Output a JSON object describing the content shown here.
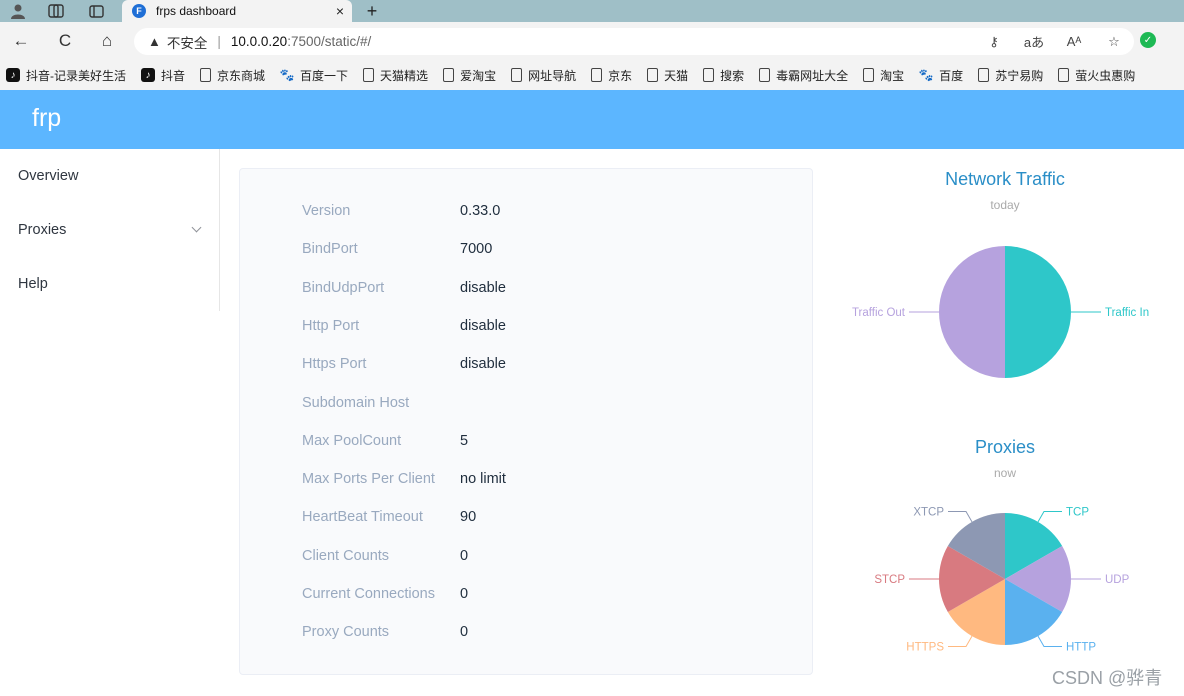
{
  "browser": {
    "tab_title": "frps dashboard",
    "tab_close": "×",
    "new_tab": "+",
    "url_warning_icon": "warning-icon",
    "url_insecure": "不安全",
    "url_separator": "|",
    "url_host": "10.0.0.20",
    "url_path": ":7500/static/#/",
    "nav": {
      "back": "←",
      "refresh": "C",
      "home": "⌂"
    },
    "url_icons": [
      "⚷",
      "aあ",
      "Aᴬ",
      "☆"
    ],
    "bookmarks": [
      {
        "label": "抖音-记录美好生活",
        "icon": "tiktok-icon"
      },
      {
        "label": "抖音",
        "icon": "tiktok-icon"
      },
      {
        "label": "京东商城",
        "icon": "page-icon"
      },
      {
        "label": "百度一下",
        "icon": "baidu-paw-icon"
      },
      {
        "label": "天猫精选",
        "icon": "page-icon"
      },
      {
        "label": "爱淘宝",
        "icon": "page-icon"
      },
      {
        "label": "网址导航",
        "icon": "page-icon"
      },
      {
        "label": "京东",
        "icon": "page-icon"
      },
      {
        "label": "天猫",
        "icon": "page-icon"
      },
      {
        "label": "搜索",
        "icon": "page-icon"
      },
      {
        "label": "毒霸网址大全",
        "icon": "page-icon"
      },
      {
        "label": "淘宝",
        "icon": "page-icon"
      },
      {
        "label": "百度",
        "icon": "baidu-paw-icon"
      },
      {
        "label": "苏宁易购",
        "icon": "page-icon"
      },
      {
        "label": "萤火虫惠购",
        "icon": "page-icon"
      }
    ]
  },
  "app": {
    "logo": "frp",
    "menu": [
      {
        "label": "Overview"
      },
      {
        "label": "Proxies"
      },
      {
        "label": "Help"
      }
    ]
  },
  "overview": {
    "rows": [
      {
        "key": "Version",
        "value": "0.33.0"
      },
      {
        "key": "BindPort",
        "value": "7000"
      },
      {
        "key": "BindUdpPort",
        "value": "disable"
      },
      {
        "key": "Http Port",
        "value": "disable"
      },
      {
        "key": "Https Port",
        "value": "disable"
      },
      {
        "key": "Subdomain Host",
        "value": ""
      },
      {
        "key": "Max PoolCount",
        "value": "5"
      },
      {
        "key": "Max Ports Per Client",
        "value": "no limit"
      },
      {
        "key": "HeartBeat Timeout",
        "value": "90"
      },
      {
        "key": "Client Counts",
        "value": "0"
      },
      {
        "key": "Current Connections",
        "value": "0"
      },
      {
        "key": "Proxy Counts",
        "value": "0"
      }
    ]
  },
  "chart_data": [
    {
      "type": "pie",
      "title": "Network Traffic",
      "subtitle": "today",
      "slices": [
        {
          "label": "Traffic In",
          "value": 1,
          "color": "#2ec7c9"
        },
        {
          "label": "Traffic Out",
          "value": 1,
          "color": "#b6a2de"
        }
      ]
    },
    {
      "type": "pie",
      "title": "Proxies",
      "subtitle": "now",
      "slices": [
        {
          "label": "TCP",
          "value": 1,
          "color": "#2ec7c9"
        },
        {
          "label": "UDP",
          "value": 1,
          "color": "#b6a2de"
        },
        {
          "label": "HTTP",
          "value": 1,
          "color": "#5ab1ef"
        },
        {
          "label": "HTTPS",
          "value": 1,
          "color": "#ffb980"
        },
        {
          "label": "STCP",
          "value": 1,
          "color": "#d87a80"
        },
        {
          "label": "XTCP",
          "value": 1,
          "color": "#8d98b3"
        }
      ]
    }
  ],
  "watermark": "CSDN @骅青"
}
